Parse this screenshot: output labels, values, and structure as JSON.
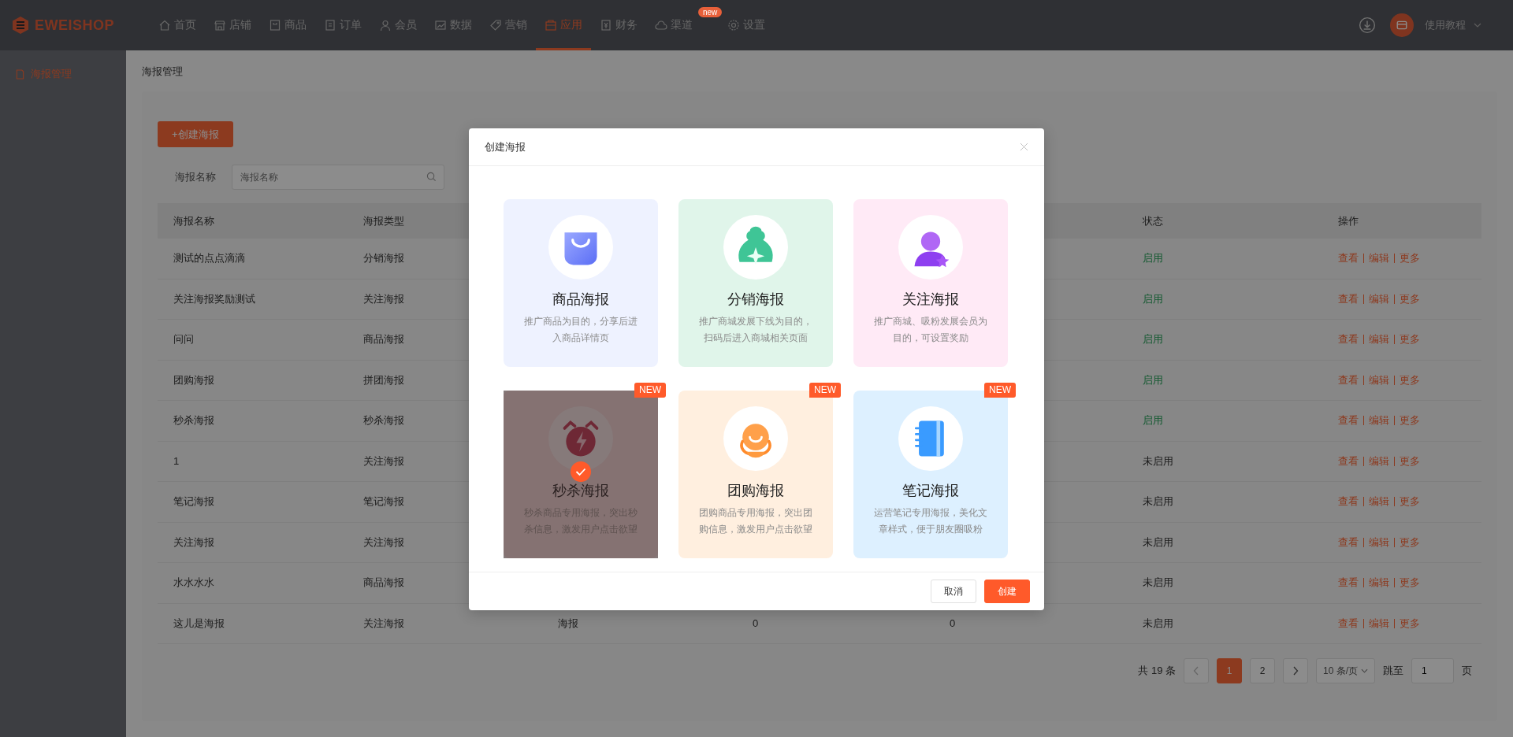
{
  "brand": {
    "name": "EWEISHOP"
  },
  "nav": [
    {
      "label": "首页",
      "selected": false
    },
    {
      "label": "店铺",
      "selected": false
    },
    {
      "label": "商品",
      "selected": false
    },
    {
      "label": "订单",
      "selected": false
    },
    {
      "label": "会员",
      "selected": false
    },
    {
      "label": "数据",
      "selected": false
    },
    {
      "label": "营销",
      "selected": false
    },
    {
      "label": "应用",
      "selected": true
    },
    {
      "label": "财务",
      "selected": false
    },
    {
      "label": "渠道",
      "selected": false,
      "badge": "new"
    },
    {
      "label": "设置",
      "selected": false
    }
  ],
  "user_menu": {
    "label": "使用教程"
  },
  "sidebar": {
    "items": [
      {
        "label": "海报管理",
        "selected": true
      }
    ]
  },
  "page_title": "海报管理",
  "create_button": "+创建海报",
  "search": {
    "label": "海报名称",
    "placeholder": "海报名称"
  },
  "table": {
    "columns": [
      "海报名称",
      "海报类型",
      "状态",
      "操作"
    ],
    "rows": [
      {
        "name": "测试的点点滴滴",
        "type": "分销海报",
        "status": "启用",
        "enabled": true,
        "actions": [
          "查看",
          "编辑",
          "更多"
        ]
      },
      {
        "name": "关注海报奖励测试",
        "type": "关注海报",
        "status": "启用",
        "enabled": true,
        "actions": [
          "查看",
          "编辑",
          "更多"
        ]
      },
      {
        "name": "问问",
        "type": "商品海报",
        "status": "启用",
        "enabled": true,
        "actions": [
          "查看",
          "编辑",
          "更多"
        ]
      },
      {
        "name": "团购海报",
        "type": "拼团海报",
        "status": "启用",
        "enabled": true,
        "actions": [
          "查看",
          "编辑",
          "更多"
        ]
      },
      {
        "name": "秒杀海报",
        "type": "秒杀海报",
        "status": "启用",
        "enabled": true,
        "actions": [
          "查看",
          "编辑",
          "更多"
        ]
      },
      {
        "name": "1",
        "type": "关注海报",
        "status": "未启用",
        "enabled": false,
        "actions": [
          "查看",
          "编辑",
          "更多"
        ]
      },
      {
        "name": "笔记海报",
        "type": "笔记海报",
        "status": "未启用",
        "enabled": false,
        "actions": [
          "查看",
          "编辑",
          "更多"
        ]
      },
      {
        "name": "关注海报",
        "type": "关注海报",
        "status": "未启用",
        "enabled": false,
        "actions": [
          "查看",
          "编辑",
          "更多"
        ]
      },
      {
        "name": "水水水水",
        "type": "商品海报",
        "status": "未启用",
        "enabled": false,
        "actions": [
          "查看",
          "编辑",
          "更多"
        ]
      },
      {
        "name": "这儿是海报",
        "type": "关注海报",
        "column_3": "海报",
        "column_4": "0",
        "column_5": "0",
        "status": "未启用",
        "enabled": false,
        "actions": [
          "查看",
          "编辑",
          "更多"
        ]
      }
    ]
  },
  "pagination": {
    "total": "共 19 条",
    "pages": [
      {
        "label": "1",
        "selected": true
      },
      {
        "label": "2",
        "selected": false
      }
    ],
    "page_size": "10 条/页",
    "jump_label": "跳至",
    "jump_value": "1",
    "suffix": "页"
  },
  "dialog": {
    "title": "创建海报",
    "cards": [
      {
        "kind": "goods",
        "title": "商品海报",
        "desc": "推广商品为目的，分享后进入商品详情页",
        "selected": false
      },
      {
        "kind": "distribution",
        "title": "分销海报",
        "desc": "推广商城发展下线为目的，扫码后进入商城相关页面",
        "selected": false
      },
      {
        "kind": "follow",
        "title": "关注海报",
        "desc": "推广商城、吸粉发展会员为目的，可设置奖励",
        "selected": false
      },
      {
        "kind": "flash",
        "title": "秒杀海报",
        "desc": "秒杀商品专用海报，突出秒杀信息，激发用户点击欲望",
        "selected": true,
        "badge": "NEW"
      },
      {
        "kind": "group",
        "title": "团购海报",
        "desc": "团购商品专用海报，突出团购信息，激发用户点击欲望",
        "selected": false,
        "badge": "NEW"
      },
      {
        "kind": "note",
        "title": "笔记海报",
        "desc": "运营笔记专用海报，美化文章样式，便于朋友圈吸粉",
        "selected": false,
        "badge": "NEW"
      }
    ],
    "buttons": {
      "cancel": "取消",
      "confirm": "创建"
    }
  }
}
